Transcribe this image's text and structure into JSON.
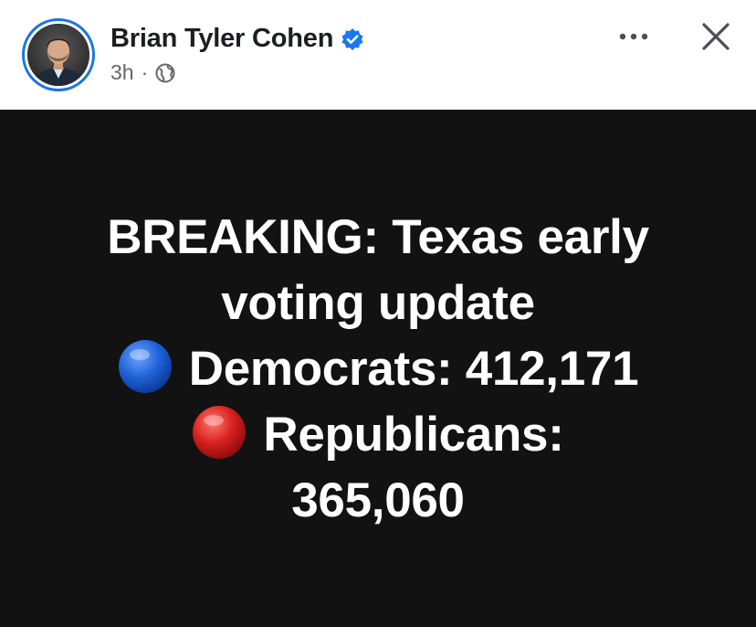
{
  "header": {
    "author_name": "Brian Tyler Cohen",
    "timestamp": "3h",
    "separator": "·",
    "privacy_icon": "globe-icon",
    "verified_icon": "verified-badge-icon",
    "more_icon": "more-options-icon",
    "close_icon": "close-icon"
  },
  "post": {
    "lines": [
      "BREAKING: Texas early",
      "voting update",
      "Democrats: 412,171",
      "Republicans:",
      "365,060"
    ],
    "bullets": {
      "democrats": "blue-circle-emoji",
      "republicans": "red-circle-emoji"
    }
  },
  "colors": {
    "card_background": "#121212",
    "accent_blue": "#1b74e4",
    "verified_blue": "#1877f2",
    "dem_blue": "#1f63d8",
    "rep_red": "#d9201f"
  }
}
